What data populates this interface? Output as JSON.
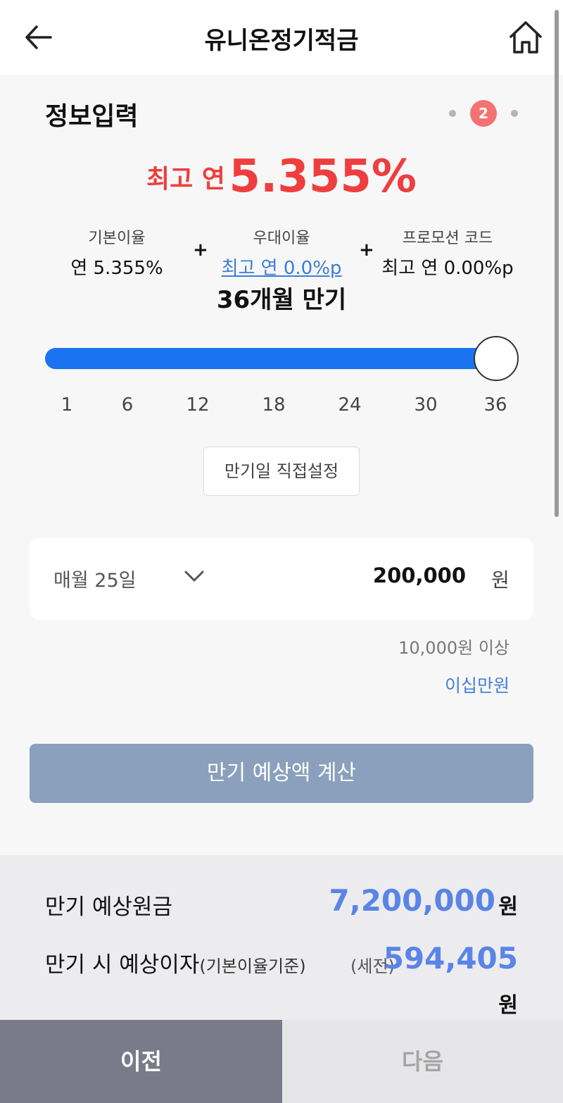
{
  "header": {
    "title": "유니온정기적금",
    "back_icon": "arrow-left-icon",
    "home_icon": "home-icon"
  },
  "section": {
    "title": "정보입력",
    "step_current": "2"
  },
  "rate": {
    "prefix": "최고 연",
    "value": "5.355%",
    "color": "#ee3e3e"
  },
  "rate_breakdown": {
    "base": {
      "label": "기본이율",
      "value": "연 5.355%"
    },
    "plus1": "+",
    "preferential": {
      "label": "우대이율",
      "value": "최고 연 0.0%p"
    },
    "plus2": "+",
    "promo": {
      "label": "프로모션 코드",
      "value": "최고 연 0.00%p"
    }
  },
  "term": {
    "label": "36개월 만기",
    "selected_months": 36,
    "slider_level_percent": 100,
    "ticks": [
      "1",
      "6",
      "12",
      "18",
      "24",
      "30",
      "36"
    ],
    "accent": "#1a73f0"
  },
  "custom_date_button": "만기일 직접설정",
  "deposit": {
    "day": "매월 25일",
    "amount": "200,000",
    "unit": "원",
    "min_note": "10,000원 이상",
    "amount_korean": "이십만원"
  },
  "calc_button": "만기 예상액 계산",
  "results": {
    "principal_label": "만기 예상원금",
    "principal_value": "7,200,000",
    "principal_unit": "원",
    "interest_label": "만기 시 예상이자",
    "interest_note": "(기본이율기준)",
    "interest_pretax": "(세전)",
    "interest_value": "594,405",
    "interest_unit": "원",
    "value_color": "#5a84e6"
  },
  "footer": {
    "prev": "이전",
    "next": "다음"
  }
}
